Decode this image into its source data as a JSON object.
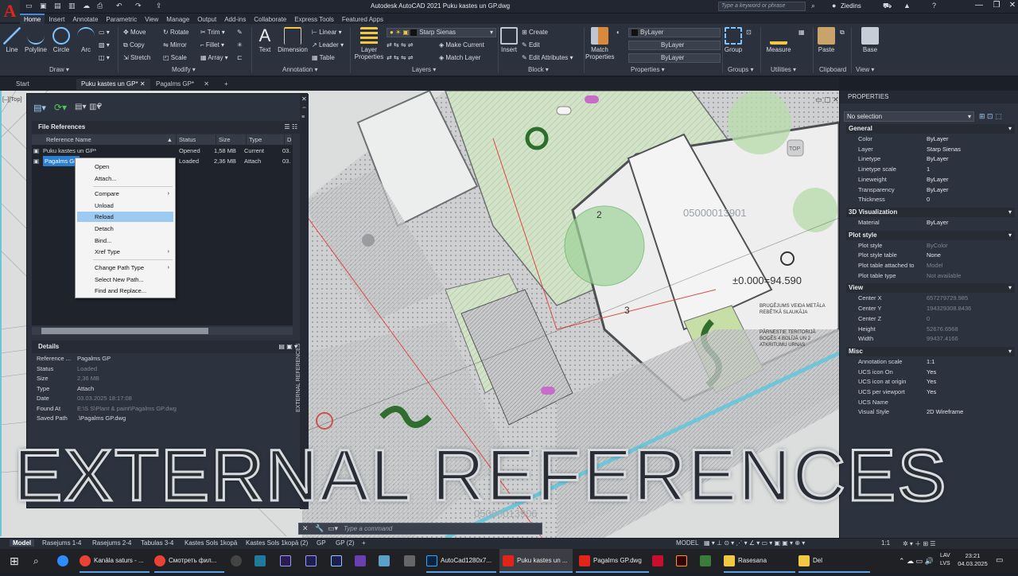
{
  "window": {
    "title": "Autodesk AutoCAD 2021   Puku kastes un GP.dwg",
    "search_placeholder": "Type a keyword or phrase",
    "user": "Ziedins",
    "app_logo": "A"
  },
  "menu_tabs": [
    "Home",
    "Insert",
    "Annotate",
    "Parametric",
    "View",
    "Manage",
    "Output",
    "Add-ins",
    "Collaborate",
    "Express Tools",
    "Featured Apps"
  ],
  "ribbon": {
    "draw": {
      "title": "Draw ▾",
      "tools": [
        "Line",
        "Polyline",
        "Circle",
        "Arc"
      ]
    },
    "modify": {
      "title": "Modify ▾",
      "rows": [
        [
          "Move",
          "Rotate",
          "Trim ▾"
        ],
        [
          "Copy",
          "Mirror",
          "Fillet ▾"
        ],
        [
          "Stretch",
          "Scale",
          "Array ▾"
        ]
      ]
    },
    "annotation": {
      "title": "Annotation ▾",
      "text": "Text",
      "dimension": "Dimension",
      "linear": "Linear ▾",
      "leader": "Leader ▾",
      "table": "Table"
    },
    "layers": {
      "title": "Layers ▾",
      "layer_properties": "Layer\nProperties",
      "current_layer": "Starp Sienas",
      "make_current": "Make Current",
      "match_layer": "Match Layer"
    },
    "block": {
      "title": "Block ▾",
      "insert": "Insert",
      "create": "Create",
      "edit": "Edit",
      "edit_attributes": "Edit Attributes ▾"
    },
    "properties": {
      "title": "Properties ▾",
      "match": "Match\nProperties",
      "bylayer": "ByLayer"
    },
    "groups": {
      "title": "Groups ▾",
      "group": "Group"
    },
    "utilities": {
      "title": "Utilities ▾",
      "measure": "Measure"
    },
    "clipboard": {
      "title": "Clipboard",
      "paste": "Paste"
    },
    "view": {
      "title": "View ▾",
      "base": "Base"
    }
  },
  "doc_tabs": [
    "Start",
    "Puku kastes un GP*",
    "Pagalms GP*"
  ],
  "viewport_label": "[–][Top]",
  "xref": {
    "file_references_title": "File References",
    "columns": [
      "Reference Name",
      "Status",
      "Size",
      "Type",
      "D"
    ],
    "rows": [
      {
        "name": "Puku kastes un GP*",
        "status": "Opened",
        "size": "1,58 MB",
        "type": "Current",
        "date": "03."
      },
      {
        "name": "Pagalms GP",
        "status": "Loaded",
        "size": "2,36 MB",
        "type": "Attach",
        "date": "03."
      }
    ],
    "details_title": "Details",
    "details": [
      {
        "key": "Reference ...",
        "value": "Pagalms GP"
      },
      {
        "key": "Status",
        "value": "Loaded"
      },
      {
        "key": "Size",
        "value": "2,36 MB"
      },
      {
        "key": "Type",
        "value": "Attach"
      },
      {
        "key": "Date",
        "value": "03.03.2025 18:17:08"
      },
      {
        "key": "Found At",
        "value": "E:\\S  S\\Plant & paint\\Pagalms GP.dwg"
      },
      {
        "key": "Saved Path",
        "value": ".\\Pagalms GP.dwg"
      }
    ],
    "palette_label": "EXTERNAL REFERENCES"
  },
  "context_menu": [
    "Open",
    "Attach...",
    "Compare",
    "Unload",
    "Reload",
    "Detach",
    "Bind...",
    "Xref Type",
    "Change Path Type",
    "Select New Path...",
    "Find and Replace..."
  ],
  "context_menu_highlight": "Reload",
  "drawing_labels": {
    "parcel": "05000013901",
    "elevation": "±0.000=94.590",
    "bottom_parcel": "05000013906",
    "note1": "BRUĢĒJUMS VEIDA METĀLA\nREBĒTKĀ SLAUKĀJA",
    "note2": "PĀRNESTIE TERITORIJĀ\nBOĢĒS 4 BOLĪJĀ UN 2\nATKRITUMU URNAS",
    "top": "TOP",
    "grid_a": "2",
    "grid_b": "3"
  },
  "properties": {
    "title": "PROPERTIES",
    "selection": "No selection",
    "sections": [
      {
        "name": "General",
        "rows": [
          {
            "k": "Color",
            "v": "ByLayer"
          },
          {
            "k": "Layer",
            "v": "Starp Sienas"
          },
          {
            "k": "Linetype",
            "v": "ByLayer"
          },
          {
            "k": "Linetype scale",
            "v": "1"
          },
          {
            "k": "Lineweight",
            "v": "ByLayer"
          },
          {
            "k": "Transparency",
            "v": "ByLayer"
          },
          {
            "k": "Thickness",
            "v": "0"
          }
        ]
      },
      {
        "name": "3D Visualization",
        "rows": [
          {
            "k": "Material",
            "v": "ByLayer"
          }
        ]
      },
      {
        "name": "Plot style",
        "rows": [
          {
            "k": "Plot style",
            "v": "ByColor"
          },
          {
            "k": "Plot style table",
            "v": "None"
          },
          {
            "k": "Plot table attached to",
            "v": "Model"
          },
          {
            "k": "Plot table type",
            "v": "Not available"
          }
        ]
      },
      {
        "name": "View",
        "rows": [
          {
            "k": "Center X",
            "v": "657279729.985"
          },
          {
            "k": "Center Y",
            "v": "194329308.8436"
          },
          {
            "k": "Center Z",
            "v": "0"
          },
          {
            "k": "Height",
            "v": "52676.6568"
          },
          {
            "k": "Width",
            "v": "99437.4166"
          }
        ]
      },
      {
        "name": "Misc",
        "rows": [
          {
            "k": "Annotation scale",
            "v": "1:1"
          },
          {
            "k": "UCS icon On",
            "v": "Yes"
          },
          {
            "k": "UCS icon at origin",
            "v": "Yes"
          },
          {
            "k": "UCS per viewport",
            "v": "Yes"
          },
          {
            "k": "UCS Name",
            "v": ""
          },
          {
            "k": "Visual Style",
            "v": "2D Wireframe"
          }
        ]
      }
    ]
  },
  "command_placeholder": "Type a command",
  "status_tabs": [
    "Model",
    "Rasejums 1-4",
    "Rasejums 2-4",
    "Tabulas 3-4",
    "Kastes Sols 1kopā",
    "Kastes Sols 1kopā (2)",
    "GP",
    "GP (2)"
  ],
  "status_right": {
    "model": "MODEL",
    "scale": "1:1",
    "lang": "LAV\nLVS",
    "time": "23:21",
    "date": "04.03.2025"
  },
  "taskbar": [
    {
      "label": "Kanāla saturs - ...",
      "color": "#ea4335"
    },
    {
      "label": "Смотреть фил...",
      "color": "#ea4335"
    },
    {
      "label": "AutoCad1280x7...",
      "color": "#31a8ff"
    },
    {
      "label": "Puku kastes un ...",
      "color": "#e1251b"
    },
    {
      "label": "Pagalms GP.dwg",
      "color": "#e1251b"
    },
    {
      "label": "Rasesana",
      "color": "#f2c744"
    },
    {
      "label": "Del",
      "color": "#f2c744"
    }
  ],
  "overlay_title": "EXTERNAL REFERENCES"
}
